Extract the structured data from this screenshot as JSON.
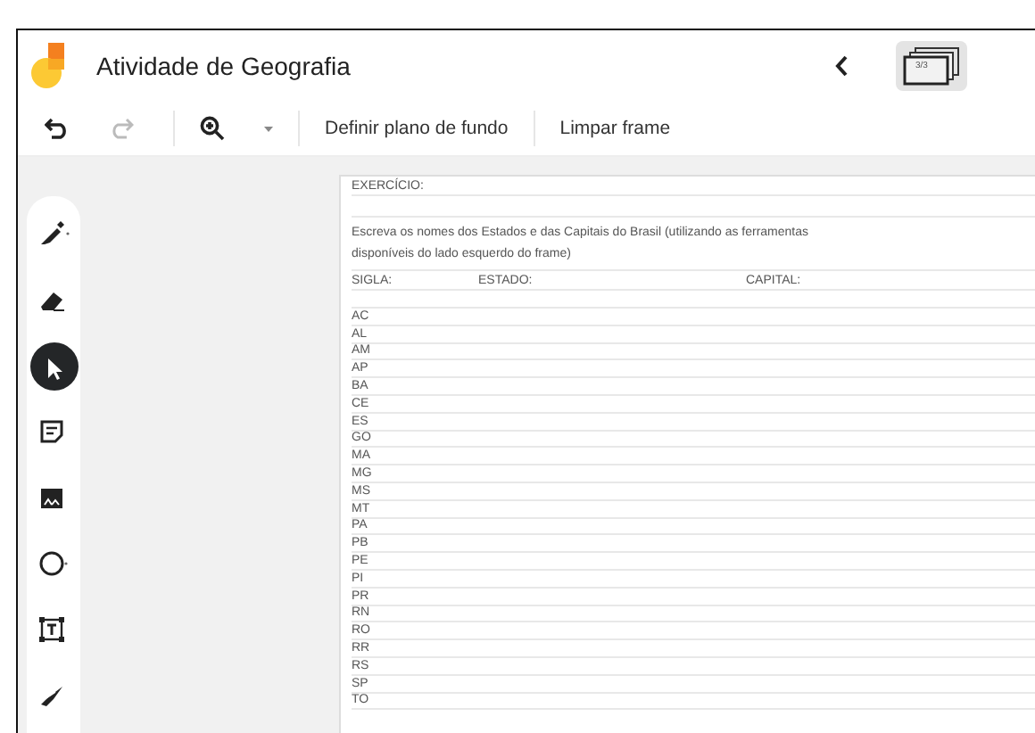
{
  "app": {
    "title": "Atividade de Geografia",
    "frame_counter": "3/3"
  },
  "toolbar": {
    "actions": [
      "Definir plano de fundo",
      "Limpar frame"
    ]
  },
  "tools": [
    {
      "kind": "pen",
      "selected": false
    },
    {
      "kind": "eraser",
      "selected": false
    },
    {
      "kind": "select",
      "selected": true
    },
    {
      "kind": "note",
      "selected": false
    },
    {
      "kind": "image",
      "selected": false
    },
    {
      "kind": "circle",
      "selected": false
    },
    {
      "kind": "textbox",
      "selected": false
    },
    {
      "kind": "laser",
      "selected": false
    }
  ],
  "document": {
    "heading": "EXERCÍCIO:",
    "instruction": [
      "Escreva os nomes dos Estados e das Capitais do Brasil (utilizando as",
      "ferramentas disponíveis do lado esquerdo do frame)"
    ],
    "columns": [
      "SIGLA:",
      "ESTADO:",
      "CAPITAL:"
    ],
    "rows": [
      "AC",
      "AL",
      "AM",
      "AP",
      "BA",
      "CE",
      "ES",
      "GO",
      "MA",
      "MG",
      "MS",
      "MT",
      "PA",
      "PB",
      "PE",
      "PI",
      "PR",
      "RN",
      "RO",
      "RR",
      "RS",
      "SP",
      "TO"
    ]
  }
}
